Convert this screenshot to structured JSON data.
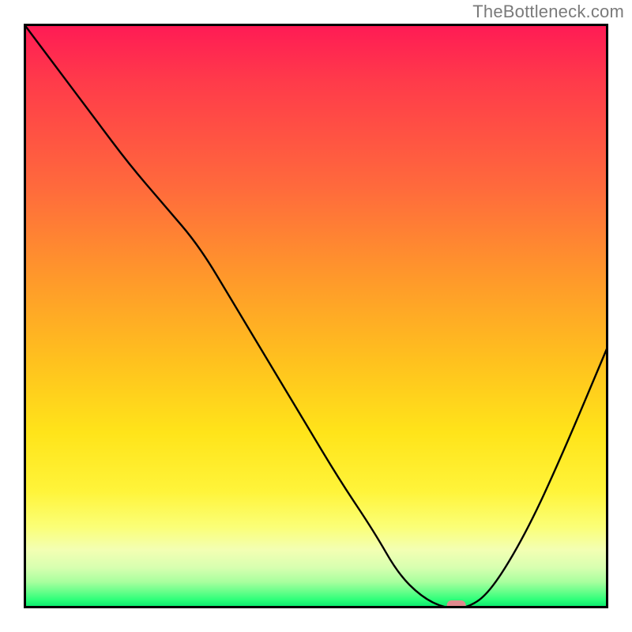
{
  "attribution": "TheBottleneck.com",
  "chart_data": {
    "type": "line",
    "title": "",
    "xlabel": "",
    "ylabel": "",
    "xlim": [
      0,
      100
    ],
    "ylim": [
      0,
      100
    ],
    "axes_visible": false,
    "ticks_visible": false,
    "grid": false,
    "background": "heat-gradient (red top → green bottom)",
    "series": [
      {
        "name": "bottleneck-curve",
        "x": [
          0,
          6,
          12,
          18,
          24,
          30,
          36,
          42,
          48,
          54,
          60,
          64,
          68,
          72,
          76,
          80,
          86,
          92,
          100
        ],
        "y": [
          100,
          92,
          84,
          76,
          69,
          62,
          52,
          42,
          32,
          22,
          13,
          6,
          2,
          0,
          0,
          3,
          13,
          26,
          45
        ]
      }
    ],
    "marker": {
      "name": "optimal-point",
      "x": 74,
      "y": 0,
      "shape": "rounded-rect",
      "color": "#e08a8e"
    },
    "notes": "No numeric axis labels are rendered; values are read proportionally from curve shape. Left segment descends steeply from top-left with slight slope break near y≈70; minimum plateau sits ~x=68–76 at y≈0; right segment rises to ~y=45 at right edge."
  }
}
